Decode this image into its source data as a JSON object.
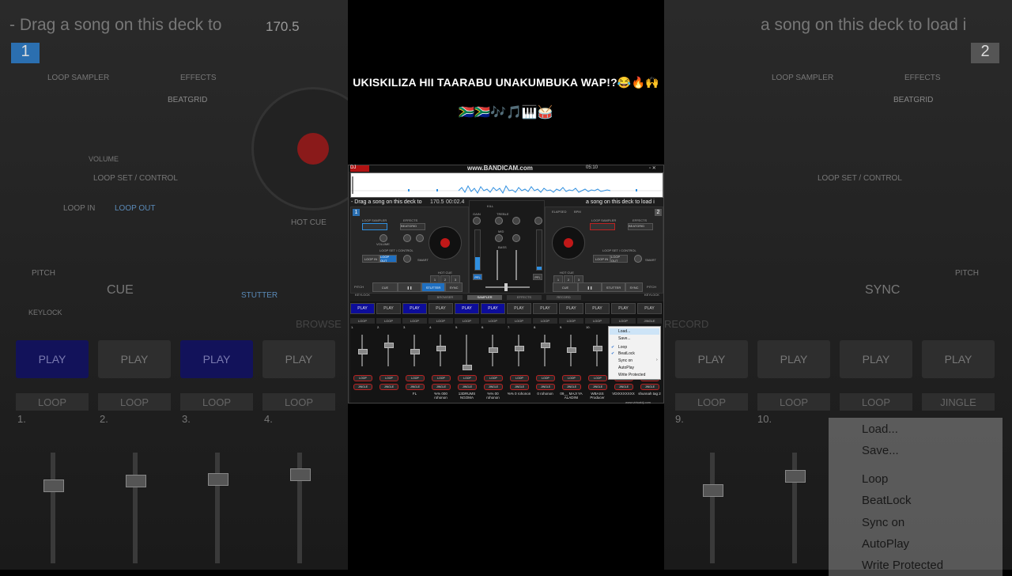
{
  "caption": {
    "line1": "UKISKILIZA HII TAARABU UNAKUMBUKA WAP!?😂🔥🙌",
    "line2": "🇿🇦🇿🇦🎶🎵🎹🥁"
  },
  "app": {
    "title": "DJ",
    "watermark": "www.BANDICAM.com",
    "clock": "05:10",
    "deck_left": {
      "number": "1",
      "drag_text": "- Drag a song on this deck to",
      "bpm_label": "BPM",
      "elapsed_label": "ELAPSED",
      "bpm": "170.5",
      "elapsed": "00:02.4",
      "loop_sampler_label": "LOOP SAMPLER",
      "effects_label": "EFFECTS",
      "effect": "BEATGRID",
      "volume_label": "VOLUME",
      "param1_label": "PARAM 1",
      "param2_label": "PARAM 2",
      "loop_set_label": "LOOP SET / CONTROL",
      "loop_in": "LOOP IN",
      "loop_out": "LOOP OUT",
      "shift": "SHIFT",
      "smart": "SMART",
      "hot_cue_label": "HOT CUE",
      "loop_sizes": [
        "1/4",
        "1/2",
        "1",
        "2",
        "4",
        "8",
        "16"
      ],
      "pitch_label": "PITCH",
      "cue": "CUE",
      "stutter": "STUTTER",
      "sync": "SYNC",
      "keylock": "KEYLOCK"
    },
    "deck_right": {
      "number": "2",
      "drag_text": "a song on this deck to load i",
      "elapsed_label": "ELAPSED",
      "bpm_label": "BPM",
      "loop_sampler_label": "LOOP SAMPLER",
      "effects_label": "EFFECTS",
      "effect": "BEATGRID",
      "loop_set_label": "LOOP SET / CONTROL",
      "loop_in": "LOOP IN",
      "loop_out": "LOOP OUT",
      "shift": "SHIFT",
      "smart": "SMART",
      "hot_cue_label": "HOT CUE",
      "loop_sizes": [
        "1/4",
        "1/2",
        "1",
        "2",
        "4",
        "8",
        "16"
      ],
      "pitch_label": "PITCH",
      "cue": "CUE",
      "stutter": "STUTTER",
      "sync": "SYNC",
      "keylock": "KEYLOCK"
    },
    "mixer": {
      "gain": "GAIN",
      "kill": "KILL",
      "treble": "TREBLE",
      "bass": "BASS",
      "mid": "MID",
      "pfl": "PFL"
    },
    "tabs": [
      "BROWSER",
      "SAMPLER",
      "EFFECTS",
      "RECORD"
    ],
    "active_tab": "SAMPLER",
    "sampler": {
      "play_label": "PLAY",
      "jingle_label": "JINGLE",
      "slots": [
        {
          "num": "1.",
          "play_active": true,
          "mode": "LOOP",
          "name": ""
        },
        {
          "num": "2.",
          "play_active": false,
          "mode": "LOOP",
          "name": ""
        },
        {
          "num": "3.",
          "play_active": true,
          "mode": "LOOP",
          "name": "FL"
        },
        {
          "num": "4.",
          "play_active": false,
          "mode": "LOOP",
          "name": "%% 000 rohonon"
        },
        {
          "num": "5.",
          "play_active": true,
          "mode": "LOOP",
          "name": "13DRUMS NGOMA"
        },
        {
          "num": "6.",
          "play_active": true,
          "mode": "LOOP",
          "name": "%% 00 rohonon"
        },
        {
          "num": "7.",
          "play_active": false,
          "mode": "LOOP",
          "name": "%% 0 rohonon"
        },
        {
          "num": "8.",
          "play_active": false,
          "mode": "LOOP",
          "name": "0 rohonon"
        },
        {
          "num": "9.",
          "play_active": false,
          "mode": "LOOP",
          "name": "09__ MAJI YA ALADINI"
        },
        {
          "num": "10.",
          "play_active": false,
          "mode": "LOOP",
          "name": "WBASS Producer"
        },
        {
          "num": "11.",
          "play_active": false,
          "mode": "LOOP",
          "name": "VDIXXXXXXX"
        },
        {
          "num": "12.",
          "play_active": false,
          "mode": "JINGLE",
          "name": "shunnah tag 2"
        }
      ]
    },
    "context_menu": {
      "items": [
        {
          "label": "Load...",
          "checked": false,
          "submenu": false
        },
        {
          "label": "Save...",
          "checked": false,
          "submenu": false
        },
        {
          "label": "Loop",
          "checked": true,
          "submenu": false
        },
        {
          "label": "BeatLock",
          "checked": true,
          "submenu": false
        },
        {
          "label": "Sync on",
          "checked": false,
          "submenu": true
        },
        {
          "label": "AutoPlay",
          "checked": false,
          "submenu": false
        },
        {
          "label": "Write Protected",
          "checked": false,
          "submenu": false
        }
      ]
    },
    "footer_url": "www.virtualdj.com"
  },
  "background": {
    "browse_tab": "BROWSE",
    "record_tab": "RECORD"
  }
}
